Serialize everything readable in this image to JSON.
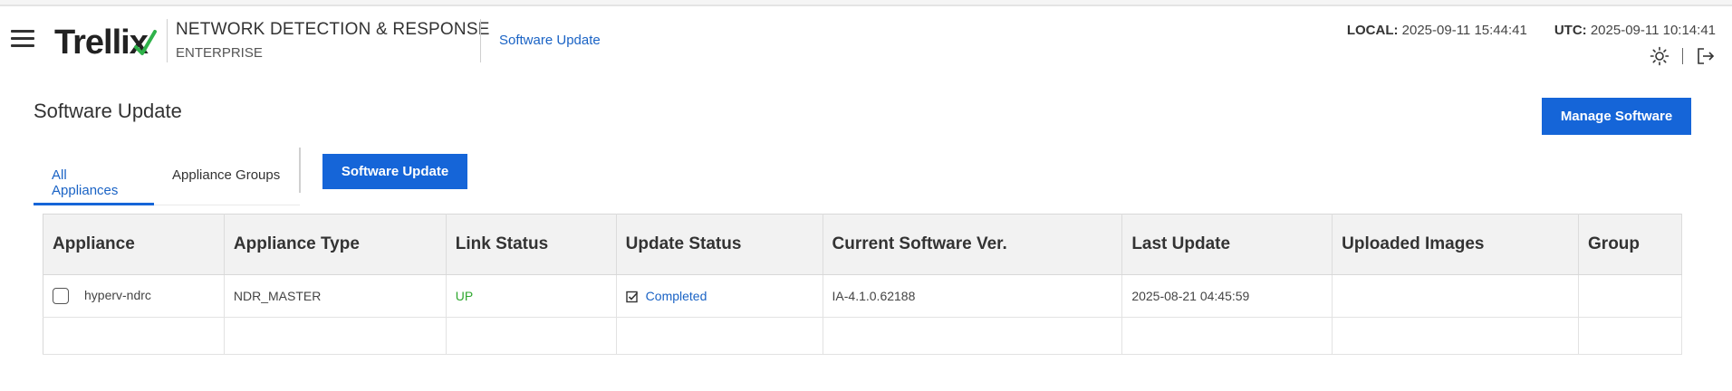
{
  "header": {
    "logo_text": "Trelli",
    "logo_x": "x",
    "product_title": "NETWORK DETECTION & RESPONSE",
    "product_subtitle": "ENTERPRISE",
    "breadcrumb": "Software Update",
    "local_label": "LOCAL:",
    "local_time": "2025-09-11 15:44:41",
    "utc_label": "UTC:",
    "utc_time": "2025-09-11 10:14:41",
    "icons": [
      "menu-icon",
      "brightness-icon",
      "logout-icon"
    ]
  },
  "page": {
    "title": "Software Update",
    "manage_button": "Manage Software",
    "software_update_button": "Software Update",
    "tabs": [
      {
        "label": "All Appliances",
        "active": true
      },
      {
        "label": "Appliance Groups",
        "active": false
      }
    ]
  },
  "table": {
    "columns": [
      "Appliance",
      "Appliance Type",
      "Link Status",
      "Update Status",
      "Current Software Ver.",
      "Last Update",
      "Uploaded Images",
      "Group"
    ],
    "rows": [
      {
        "appliance": "hyperv-ndrc",
        "type": "NDR_MASTER",
        "link_status": "UP",
        "update_status": "Completed",
        "version": "IA-4.1.0.62188",
        "last_update": "2025-08-21 04:45:59",
        "uploaded_images": "",
        "group": ""
      }
    ]
  },
  "colors": {
    "accent": "#1565d8",
    "link": "#1a63c5",
    "status_up": "#2fa82f",
    "logo_check": "#2fb24a"
  }
}
